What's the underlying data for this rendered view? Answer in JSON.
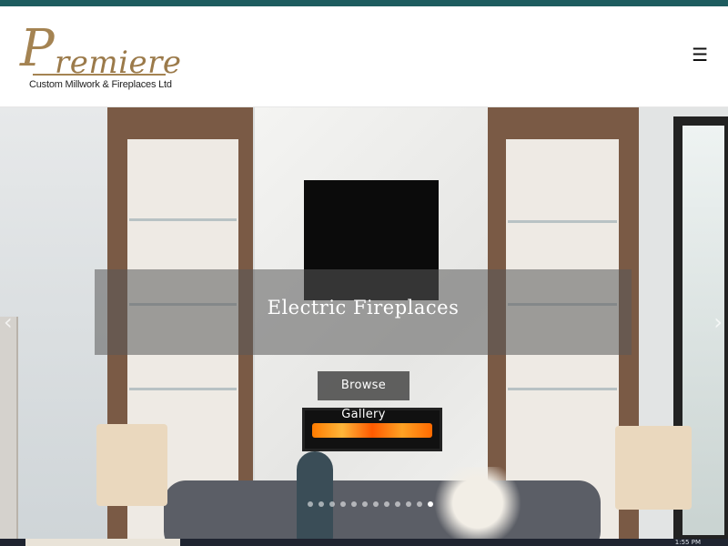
{
  "header": {
    "logo_script": "remiere",
    "logo_initial": "P",
    "logo_subtitle": "Custom Millwork & Fireplaces Ltd",
    "menu_icon": "☰"
  },
  "hero": {
    "caption": "Electric Fireplaces",
    "button_label": "Browse Gallery",
    "prev_icon": "‹",
    "next_icon": "›",
    "slides_count": 12,
    "active_slide": 11
  },
  "taskbar": {
    "clock": "1:55 PM"
  },
  "colors": {
    "topbar": "#1d5c5f",
    "logo_gold": "#a48352"
  }
}
